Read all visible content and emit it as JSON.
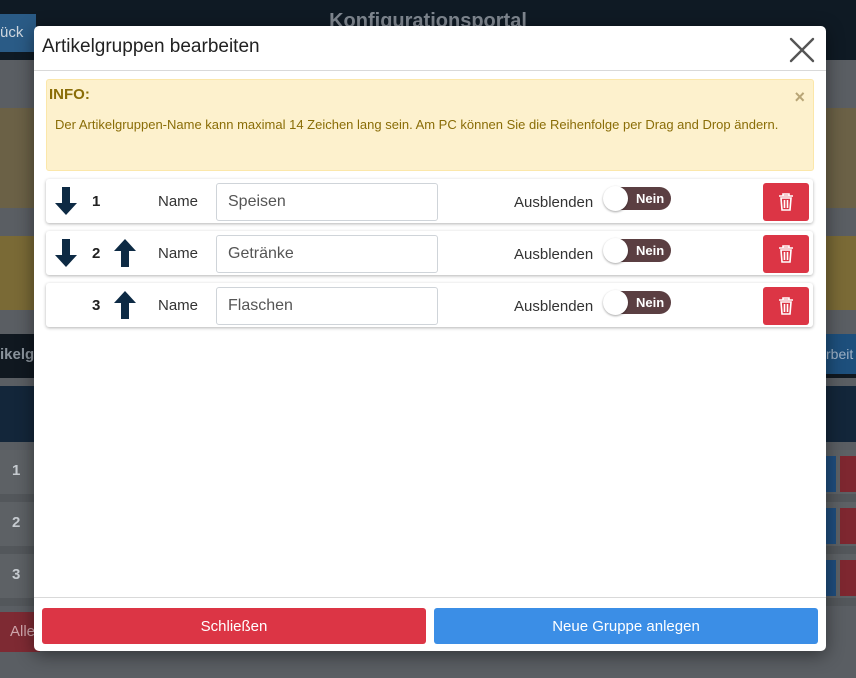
{
  "background": {
    "header_title": "Konfigurationsportal",
    "back_label": "ück",
    "bar_label": "ikelg",
    "right_btn_label": "rbeit",
    "rows": [
      "1",
      "2",
      "3"
    ],
    "all_label": "Alle"
  },
  "modal": {
    "title": "Artikelgruppen bearbeiten",
    "close_icon": "close-icon"
  },
  "info": {
    "title": "INFO:",
    "text": "Der Artikelgruppen-Name kann maximal 14 Zeichen lang sein. Am PC können Sie die Reihenfolge per Drag and Drop ändern.",
    "close": "×"
  },
  "groups": [
    {
      "number": "1",
      "name_label": "Name",
      "name_value": "Speisen",
      "hide_label": "Ausblenden",
      "toggle_text": "Nein",
      "has_down": true,
      "has_up": false
    },
    {
      "number": "2",
      "name_label": "Name",
      "name_value": "Getränke",
      "hide_label": "Ausblenden",
      "toggle_text": "Nein",
      "has_down": true,
      "has_up": true
    },
    {
      "number": "3",
      "name_label": "Name",
      "name_value": "Flaschen",
      "hide_label": "Ausblenden",
      "toggle_text": "Nein",
      "has_down": false,
      "has_up": true
    }
  ],
  "footer": {
    "close_label": "Schließen",
    "new_group_label": "Neue Gruppe anlegen"
  },
  "colors": {
    "danger": "#dc3545",
    "primary": "#3b8ee6",
    "arrow": "#0d2a44",
    "toggle_off": "#5b3f42",
    "info_bg": "#fdf1cd",
    "info_text": "#8a6d07"
  }
}
